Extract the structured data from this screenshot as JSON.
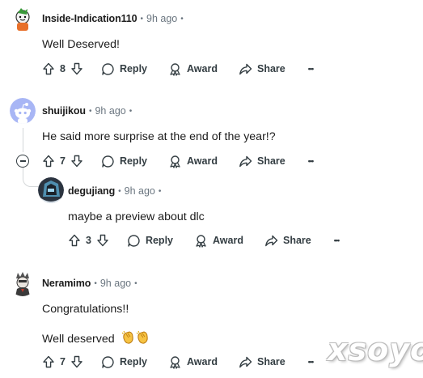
{
  "comments": [
    {
      "username": "Inside-Indication110",
      "time": "9h ago",
      "body": "Well Deserved!",
      "votes": "8",
      "reply": "Reply",
      "award": "Award",
      "share": "Share"
    },
    {
      "username": "shuijikou",
      "time": "9h ago",
      "body": "He said more surprise at the end of the year!?",
      "votes": "7",
      "reply": "Reply",
      "award": "Award",
      "share": "Share"
    },
    {
      "username": "degujiang",
      "time": "9h ago",
      "body": "maybe a preview about dlc",
      "votes": "3",
      "reply": "Reply",
      "award": "Award",
      "share": "Share"
    },
    {
      "username": "Neramimo",
      "time": "9h ago",
      "body": "Congratulations!!",
      "body2": "Well deserved",
      "emoji": "clapping-hands-emoji",
      "votes": "7",
      "reply": "Reply",
      "award": "Award",
      "share": "Share"
    }
  ],
  "separator": "•",
  "more_label": "•••",
  "watermark": "xsoyo",
  "colors": {
    "text": "#1c1c1c",
    "meta": "#6b7680",
    "action": "#333d42",
    "thread_line": "#d4d7d9",
    "snoo_avatar_bg": "#a8b6f5"
  }
}
